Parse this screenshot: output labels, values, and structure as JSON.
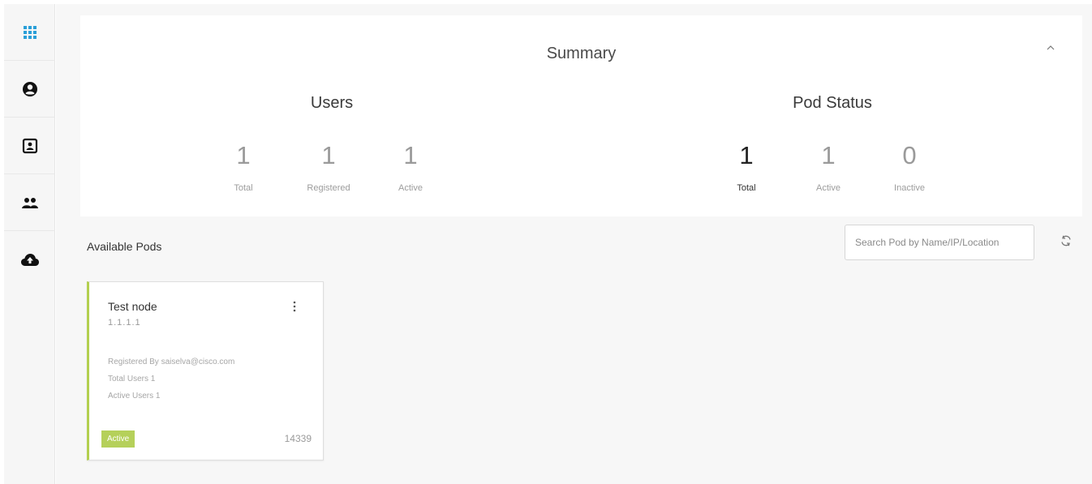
{
  "sidebar": {
    "items": [
      {
        "icon": "apps-grid-icon",
        "active": true
      },
      {
        "icon": "account-circle-icon",
        "active": false
      },
      {
        "icon": "contact-card-icon",
        "active": false
      },
      {
        "icon": "group-icon",
        "active": false
      },
      {
        "icon": "cloud-upload-icon",
        "active": false
      }
    ]
  },
  "summary": {
    "title": "Summary",
    "collapse_icon": "chevron-up-icon",
    "users": {
      "title": "Users",
      "stats": [
        {
          "value": "1",
          "label": "Total"
        },
        {
          "value": "1",
          "label": "Registered"
        },
        {
          "value": "1",
          "label": "Active"
        }
      ]
    },
    "pod_status": {
      "title": "Pod Status",
      "stats": [
        {
          "value": "1",
          "label": "Total"
        },
        {
          "value": "1",
          "label": "Active"
        },
        {
          "value": "0",
          "label": "Inactive"
        }
      ]
    }
  },
  "pods_section": {
    "title": "Available Pods",
    "search_placeholder": "Search Pod by Name/IP/Location",
    "refresh_icon": "refresh-icon"
  },
  "pods": [
    {
      "name": "Test node",
      "ip": "1.1.1.1",
      "registered_by": "Registered By saiselva@cisco.com",
      "total_users": "Total Users 1",
      "active_users": "Active Users 1",
      "status": "Active",
      "port": "14339"
    }
  ],
  "colors": {
    "accent": "#2a9fd8",
    "status_active": "#b5d05a",
    "card_border_active": "#b3cf4f"
  }
}
